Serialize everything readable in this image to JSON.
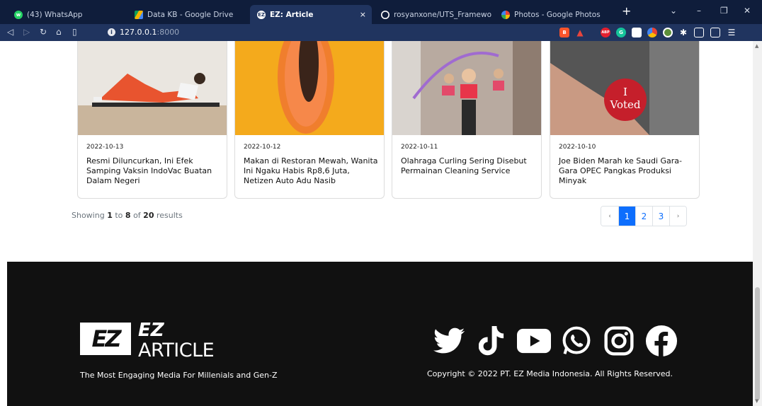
{
  "browser": {
    "tabs": [
      {
        "label": "(43) WhatsApp",
        "icon": "whatsapp-icon",
        "color": "#25d366"
      },
      {
        "label": "Data KB - Google Drive",
        "icon": "google-drive-icon",
        "color": "#f4b400"
      },
      {
        "label": "EZ: Article",
        "icon": "ez-article-icon",
        "color": "#ffffff"
      },
      {
        "label": "rosyanxone/UTS_Framework",
        "icon": "github-icon",
        "color": "#ffffff"
      },
      {
        "label": "Photos - Google Photos",
        "icon": "google-photos-icon",
        "color": "#ea4335"
      }
    ],
    "close_glyph": "×",
    "new_tab_glyph": "+",
    "url_host": "127.0.0.1",
    "url_port": ":8000"
  },
  "articles": [
    {
      "date": "2022-10-13",
      "title": "Resmi Diluncurkan, Ini Efek Samping Vaksin IndoVac Buatan Dalam Negeri"
    },
    {
      "date": "2022-10-12",
      "title": "Makan di Restoran Mewah, Wanita Ini Ngaku Habis Rp8,6 Juta, Netizen Auto Adu Nasib"
    },
    {
      "date": "2022-10-11",
      "title": "Olahraga Curling Sering Disebut Permainan Cleaning Service"
    },
    {
      "date": "2022-10-10",
      "title": "Joe Biden Marah ke Saudi Gara-Gara OPEC Pangkas Produksi Minyak"
    }
  ],
  "voted_sticker": {
    "line1": "I",
    "line2": "Voted"
  },
  "results": {
    "prefix": "Showing",
    "from": "1",
    "to_word": "to",
    "to": "8",
    "of_word": "of",
    "total": "20",
    "suffix": "results"
  },
  "pagination": {
    "prev": "‹",
    "pages": [
      "1",
      "2",
      "3"
    ],
    "next": "›",
    "active": "1"
  },
  "footer": {
    "logo_mark": "EZ",
    "logo_line1": "EZ",
    "logo_line2": "ARTICLE",
    "tagline": "The Most Engaging Media For Millenials and Gen-Z",
    "copyright": "Copyright © 2022 PT. EZ Media Indonesia. All Rights Reserved.",
    "socials": [
      "twitter-icon",
      "tiktok-icon",
      "youtube-icon",
      "whatsapp-icon",
      "instagram-icon",
      "facebook-icon"
    ]
  },
  "colors": {
    "accent": "#0d6efd",
    "footer_bg": "#111111",
    "browser_bg": "#0f1d3b",
    "toolbar_bg": "#20345f"
  }
}
